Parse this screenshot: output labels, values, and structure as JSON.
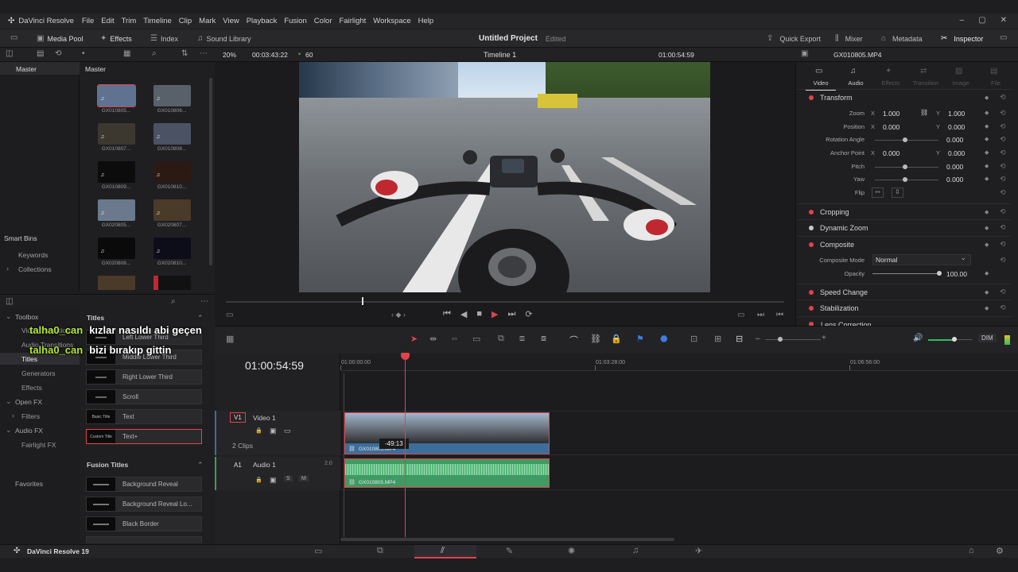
{
  "app": {
    "title": "DaVinci Resolve",
    "footer_name": "DaVinci Resolve 19"
  },
  "menu": [
    "File",
    "Edit",
    "Trim",
    "Timeline",
    "Clip",
    "Mark",
    "View",
    "Playback",
    "Fusion",
    "Color",
    "Fairlight",
    "Workspace",
    "Help"
  ],
  "toolbar": {
    "media_pool": "Media Pool",
    "effects": "Effects",
    "index": "Index",
    "sound_library": "Sound Library",
    "project_title": "Untitled Project",
    "project_status": "Edited",
    "quick_export": "Quick Export",
    "mixer": "Mixer",
    "metadata": "Metadata",
    "inspector": "Inspector"
  },
  "viewer_bar": {
    "zoom": "20%",
    "timecode": "00:03:43:22",
    "fps": "60",
    "timeline_name": "Timeline 1",
    "current_tc": "01:00:54:59",
    "clip_name": "GX010805.MP4"
  },
  "media_pool": {
    "left_header": "Master",
    "bin_header": "Master",
    "clips": [
      "GX010805...",
      "GX010806...",
      "GX010807...",
      "GX010808...",
      "GX010809...",
      "GX010810...",
      "GX020805...",
      "GX020807...",
      "GX020808...",
      "GX020810..."
    ],
    "smart_bins": "Smart Bins",
    "keywords": "Keywords",
    "collections": "Collections"
  },
  "effects": {
    "toolbox": "Toolbox",
    "video_transitions": "Video Transitions",
    "audio_transitions": "Audio Transitions",
    "titles": "Titles",
    "generators": "Generators",
    "effects_item": "Effects",
    "open_fx": "Open FX",
    "filters": "Filters",
    "audio_fx": "Audio FX",
    "fairlight_fx": "Fairlight FX",
    "favorites": "Favorites",
    "titles_header": "Titles",
    "title_items": [
      {
        "thumb": "",
        "name": "Left Lower Third"
      },
      {
        "thumb": "",
        "name": "Middle Lower Third"
      },
      {
        "thumb": "",
        "name": "Right Lower Third"
      },
      {
        "thumb": "",
        "name": "Scroll"
      },
      {
        "thumb": "Basic Title",
        "name": "Text"
      },
      {
        "thumb": "Custom Title",
        "name": "Text+"
      }
    ],
    "fusion_header": "Fusion Titles",
    "fusion_items": [
      {
        "thumb": "",
        "name": "Background Reveal"
      },
      {
        "thumb": "",
        "name": "Background Reveal Lo..."
      },
      {
        "thumb": "",
        "name": "Black Border"
      }
    ]
  },
  "chat": [
    {
      "user": "talha0_can",
      "text": "kızlar nasıldı abi geçen"
    },
    {
      "user": "talha0_can",
      "text": "bizi bırakıp gittin"
    }
  ],
  "timeline": {
    "timecode": "01:00:54:59",
    "ruler": [
      "01:00:00:00",
      "01:03:28:00",
      "01:06:56:00"
    ],
    "v1": {
      "tag": "V1",
      "name": "Video 1",
      "clips": "2 Clips"
    },
    "a1": {
      "tag": "A1",
      "name": "Audio 1",
      "level": "2.0"
    },
    "video_clip": "GX010805.MP4",
    "audio_clip": "GX010805.MP4",
    "trim_tooltip": "-49:13",
    "solo": "S",
    "mute": "M",
    "dim": "DIM"
  },
  "inspector": {
    "tabs": [
      "Video",
      "Audio",
      "Effects",
      "Transition",
      "Image",
      "File"
    ],
    "transform": "Transform",
    "zoom": {
      "label": "Zoom",
      "x": "1.000",
      "y": "1.000"
    },
    "position": {
      "label": "Position",
      "x": "0.000",
      "y": "0.000"
    },
    "rotation": {
      "label": "Rotation Angle",
      "value": "0.000"
    },
    "anchor": {
      "label": "Anchor Point",
      "x": "0.000",
      "y": "0.000"
    },
    "pitch": {
      "label": "Pitch",
      "value": "0.000"
    },
    "yaw": {
      "label": "Yaw",
      "value": "0.000"
    },
    "flip": "Flip",
    "x_letter": "X",
    "y_letter": "Y",
    "cropping": "Cropping",
    "dynamic_zoom": "Dynamic Zoom",
    "composite": "Composite",
    "composite_mode": {
      "label": "Composite Mode",
      "value": "Normal"
    },
    "opacity": {
      "label": "Opacity",
      "value": "100.00"
    },
    "speed_change": "Speed Change",
    "stabilization": "Stabilization",
    "lens_correction": "Lens Correction"
  },
  "colors": {
    "accent_red": "#e0434b",
    "video_clip": "#3c6e9b",
    "audio_clip": "#3f9a63",
    "chat_user": "#b6e82b"
  }
}
